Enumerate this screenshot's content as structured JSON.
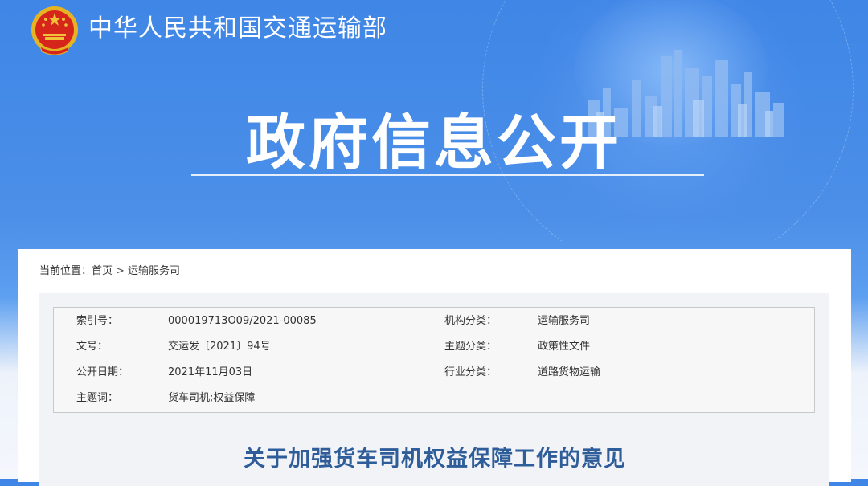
{
  "header": {
    "ministry_name": "中华人民共和国交通运输部",
    "section_title": "政府信息公开",
    "colors": {
      "banner_blue": "#4489e8",
      "title_text": "#ffffff",
      "doc_title": "#2f5d9a"
    }
  },
  "breadcrumb": {
    "prefix": "当前位置：",
    "home": "首页",
    "separator": ">",
    "current": "运输服务司"
  },
  "metadata": {
    "index_label": "索引号：",
    "index_value": "000019713O09/2021-00085",
    "org_label": "机构分类：",
    "org_value": "运输服务司",
    "docno_label": "文号：",
    "docno_value": "交运发〔2021〕94号",
    "topic_label": "主题分类：",
    "topic_value": "政策性文件",
    "date_label": "公开日期：",
    "date_value": "2021年11月03日",
    "industry_label": "行业分类：",
    "industry_value": "道路货物运输",
    "keywords_label": "主题词：",
    "keywords_value": "货车司机;权益保障"
  },
  "document": {
    "title": "关于加强货车司机权益保障工作的意见"
  },
  "icons": [
    "national-emblem-icon",
    "city-skyline-decoration"
  ]
}
